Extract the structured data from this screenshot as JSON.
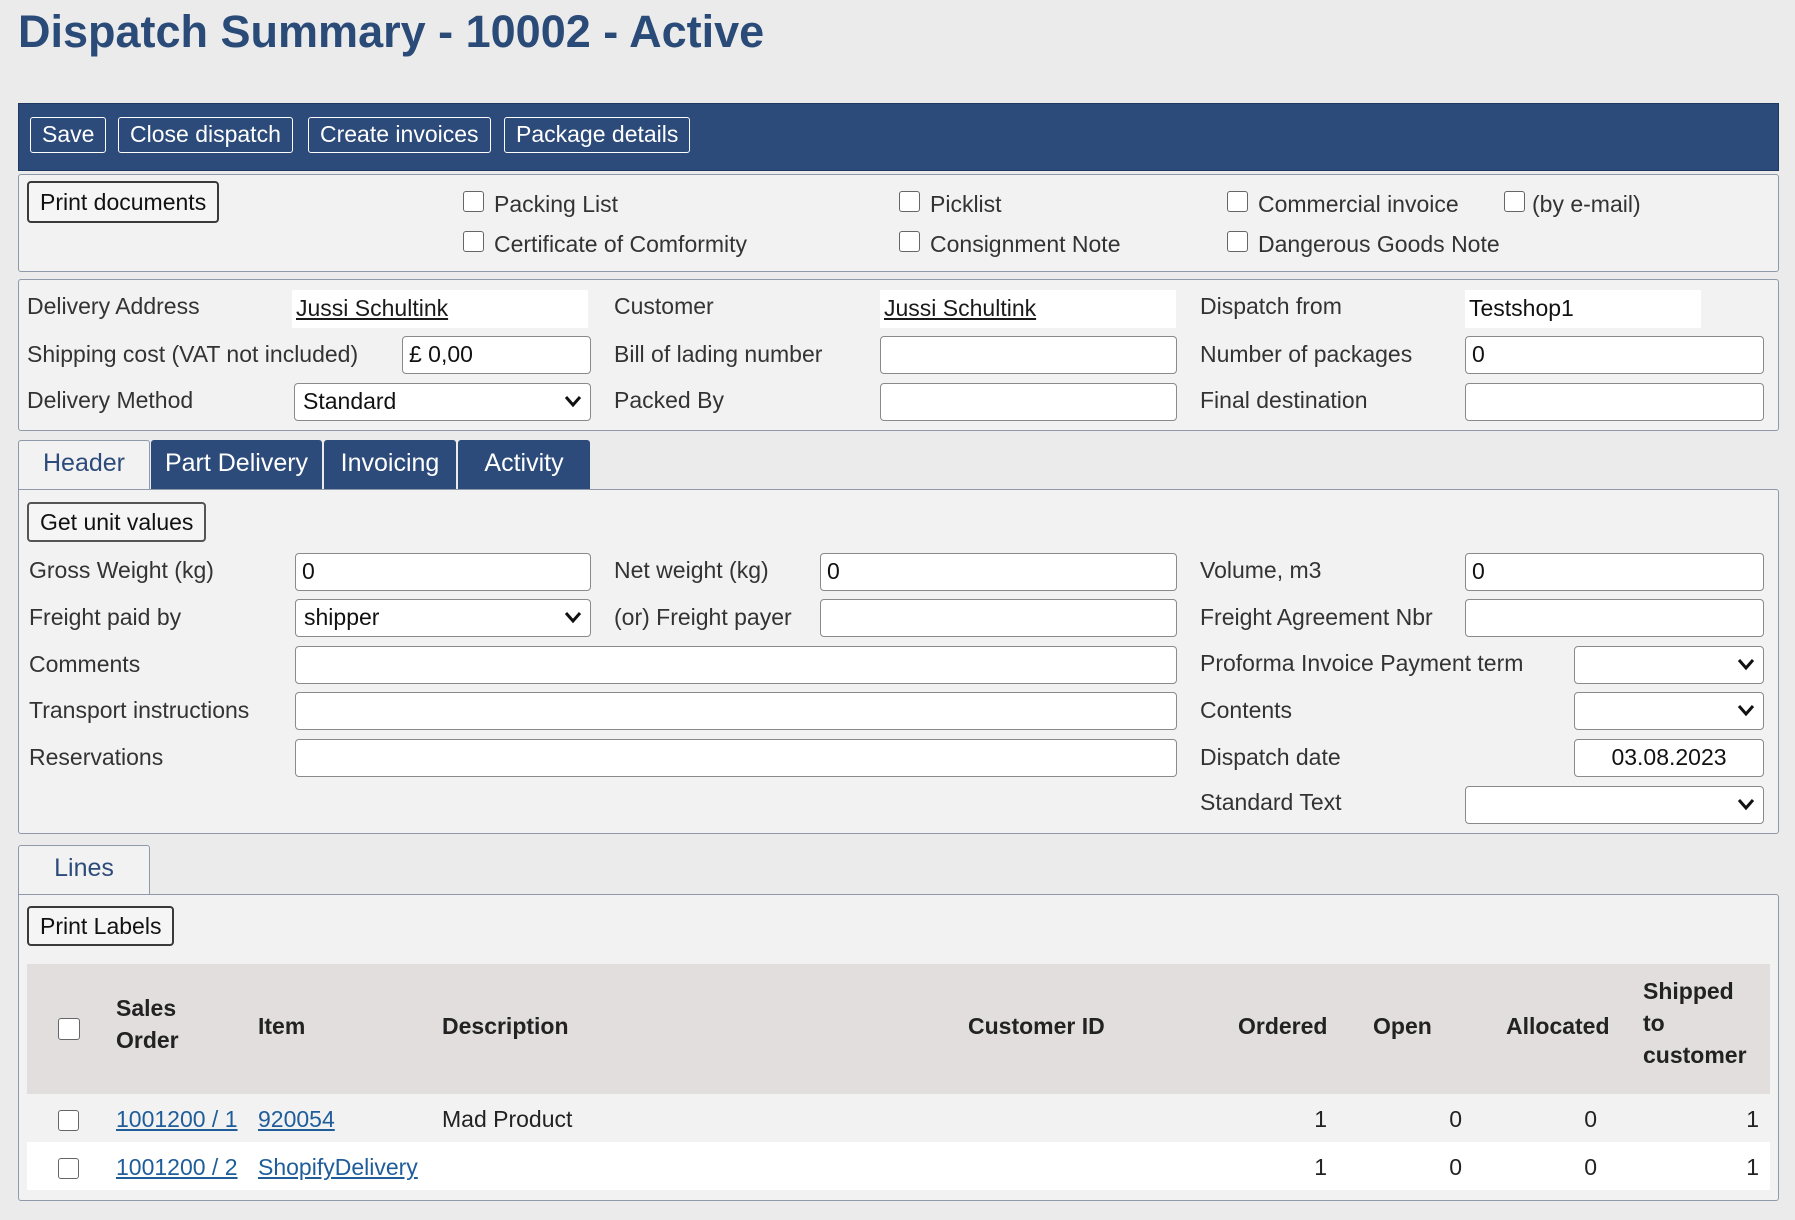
{
  "page": {
    "title": "Dispatch Summary - 10002 - Active"
  },
  "toolbar": {
    "save": "Save",
    "close_dispatch": "Close dispatch",
    "create_invoices": "Create invoices",
    "package_details": "Package details"
  },
  "print": {
    "button": "Print documents",
    "packing_list": "Packing List",
    "certificate": "Certificate of Comformity",
    "picklist": "Picklist",
    "consignment_note": "Consignment Note",
    "commercial_invoice": "Commercial invoice",
    "by_email": "(by e-mail)",
    "dangerous_goods": "Dangerous Goods Note"
  },
  "summary": {
    "delivery_address_label": "Delivery Address",
    "delivery_address_value": "Jussi Schultink",
    "customer_label": "Customer",
    "customer_value": "Jussi Schultink",
    "dispatch_from_label": "Dispatch from",
    "dispatch_from_value": "Testshop1",
    "shipping_cost_label": "Shipping cost (VAT not included)",
    "shipping_cost_value": "£ 0,00",
    "bill_of_lading_label": "Bill of lading number",
    "bill_of_lading_value": "",
    "num_packages_label": "Number of packages",
    "num_packages_value": "0",
    "delivery_method_label": "Delivery Method",
    "delivery_method_value": "Standard",
    "packed_by_label": "Packed By",
    "packed_by_value": "",
    "final_destination_label": "Final destination",
    "final_destination_value": ""
  },
  "tabs": {
    "header": "Header",
    "part_delivery": "Part Delivery",
    "invoicing": "Invoicing",
    "activity": "Activity"
  },
  "header_tab": {
    "get_unit_values": "Get unit values",
    "gross_weight_label": "Gross Weight (kg)",
    "gross_weight_value": "0",
    "net_weight_label": "Net weight (kg)",
    "net_weight_value": "0",
    "volume_label": "Volume, m3",
    "volume_value": "0",
    "freight_paid_by_label": "Freight paid by",
    "freight_paid_by_value": "shipper",
    "freight_payer_label": "(or) Freight payer",
    "freight_payer_value": "",
    "freight_agreement_label": "Freight Agreement Nbr",
    "freight_agreement_value": "",
    "comments_label": "Comments",
    "comments_value": "",
    "proforma_label": "Proforma Invoice Payment term",
    "proforma_value": "",
    "transport_label": "Transport instructions",
    "transport_value": "",
    "contents_label": "Contents",
    "contents_value": "",
    "reservations_label": "Reservations",
    "reservations_value": "",
    "dispatch_date_label": "Dispatch date",
    "dispatch_date_value": "03.08.2023",
    "standard_text_label": "Standard Text",
    "standard_text_value": ""
  },
  "lines": {
    "tab": "Lines",
    "print_labels": "Print Labels",
    "columns": {
      "sales_order_1": "Sales",
      "sales_order_2": "Order",
      "item": "Item",
      "description": "Description",
      "customer_id": "Customer ID",
      "ordered": "Ordered",
      "open": "Open",
      "allocated": "Allocated",
      "shipped_1": "Shipped",
      "shipped_2": "to",
      "shipped_3": "customer"
    },
    "rows": [
      {
        "sales_order": "1001200 / 1",
        "item": "920054",
        "description": "Mad Product",
        "customer_id": "",
        "ordered": "1",
        "open": "0",
        "allocated": "0",
        "shipped": "1"
      },
      {
        "sales_order": "1001200 / 2",
        "item": "ShopifyDelivery",
        "description": "",
        "customer_id": "",
        "ordered": "1",
        "open": "0",
        "allocated": "0",
        "shipped": "1"
      }
    ]
  }
}
